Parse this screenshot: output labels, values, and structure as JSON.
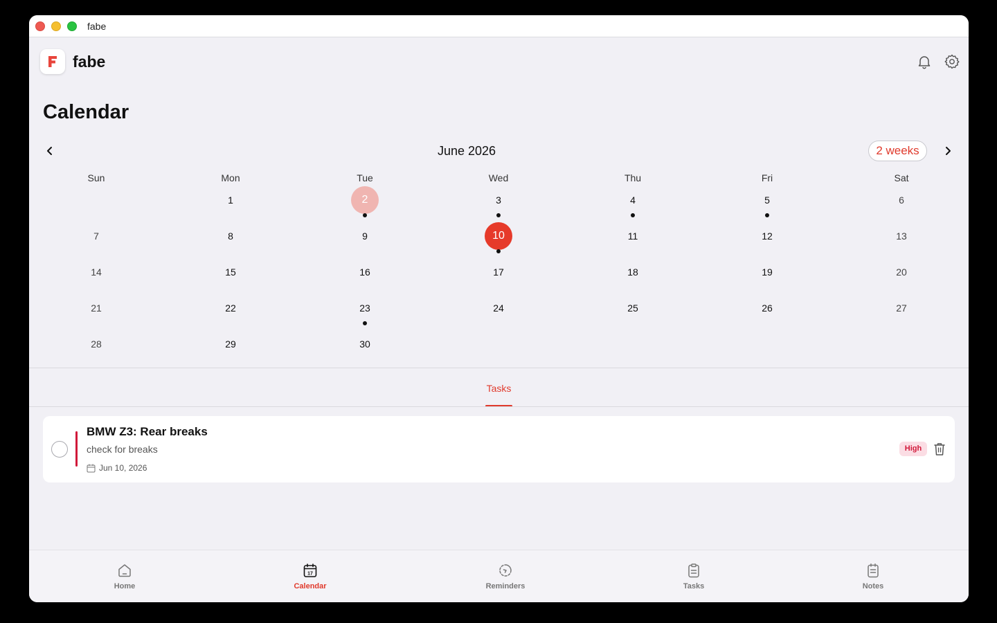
{
  "window": {
    "title": "fabe"
  },
  "header": {
    "app_name": "fabe"
  },
  "page": {
    "title": "Calendar"
  },
  "calendar": {
    "month_label": "June 2026",
    "range_label": "2 weeks",
    "weekdays": [
      "Sun",
      "Mon",
      "Tue",
      "Wed",
      "Thu",
      "Fri",
      "Sat"
    ],
    "weeks": [
      [
        "",
        "1",
        "2",
        "3",
        "4",
        "5",
        "6"
      ],
      [
        "7",
        "8",
        "9",
        "10",
        "11",
        "12",
        "13"
      ],
      [
        "14",
        "15",
        "16",
        "17",
        "18",
        "19",
        "20"
      ],
      [
        "21",
        "22",
        "23",
        "24",
        "25",
        "26",
        "27"
      ],
      [
        "28",
        "29",
        "30",
        "",
        "",
        "",
        ""
      ]
    ],
    "selected_day": "2",
    "today": "10",
    "days_with_events": [
      "2",
      "3",
      "4",
      "5",
      "10",
      "23"
    ]
  },
  "tabs": {
    "tasks": "Tasks"
  },
  "task": {
    "title": "BMW Z3: Rear breaks",
    "description": "check for breaks",
    "date": "Jun 10, 2026",
    "priority": "High"
  },
  "bottom_nav": {
    "items": [
      {
        "label": "Home"
      },
      {
        "label": "Calendar"
      },
      {
        "label": "Reminders"
      },
      {
        "label": "Tasks"
      },
      {
        "label": "Notes"
      }
    ]
  },
  "colors": {
    "accent": "#e03a2c",
    "today_bg": "#e63a2a",
    "selected_bg": "#f0b5b1",
    "priority_high": "#d1193a"
  }
}
